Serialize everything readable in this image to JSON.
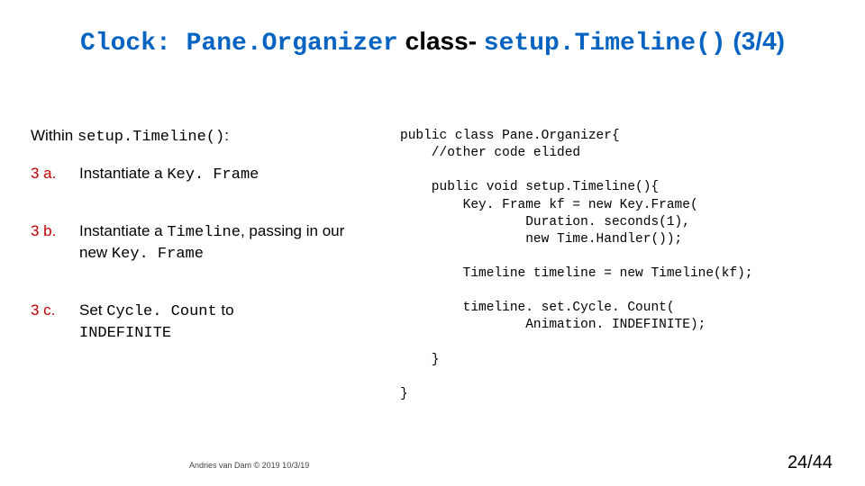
{
  "title": {
    "part1": "Clock: Pane.Organizer",
    "part2": " class- ",
    "part3": "setup.Timeline()",
    "part4": " (3/4)"
  },
  "within_label": "Within ",
  "within_method": "setup.Timeline()",
  "within_colon": ":",
  "steps": {
    "a": {
      "num": "3 a.",
      "pre": "Instantiate a ",
      "code": "Key. Frame"
    },
    "b": {
      "num": "3 b.",
      "pre": "Instantiate a ",
      "code": "Timeline",
      "mid": ", passing in our new ",
      "code2": "Key. Frame"
    },
    "c": {
      "num": "3 c.",
      "pre": "Set ",
      "code": "Cycle. Count",
      "mid": " to ",
      "code2": "INDEFINITE"
    }
  },
  "code_block": "public class Pane.Organizer{\n    //other code elided\n\n    public void setup.Timeline(){\n        Key. Frame kf = new Key.Frame(\n                Duration. seconds(1),\n                new Time.Handler());\n\n        Timeline timeline = new Timeline(kf);\n\n        timeline. set.Cycle. Count(\n                Animation. INDEFINITE);\n\n    }\n\n}",
  "footer": {
    "credit": "Andries van Dam © 2019 10/3/19",
    "page": "24/44"
  }
}
